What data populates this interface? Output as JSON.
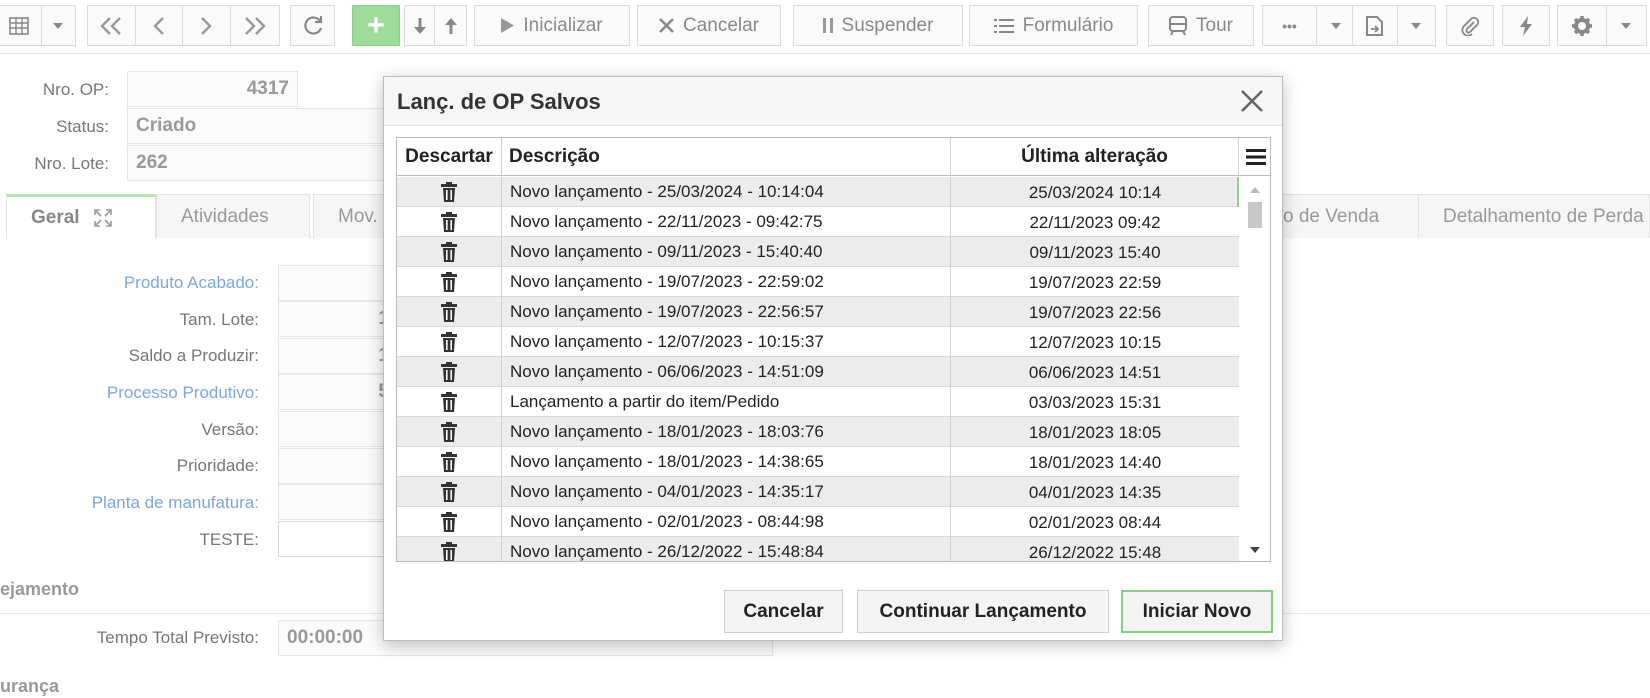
{
  "toolbar": {
    "add_label": "+",
    "start_label": "Inicializar",
    "cancel_label": "Cancelar",
    "suspend_label": "Suspender",
    "form_label": "Formulário",
    "tour_label": "Tour",
    "more_label": "•••"
  },
  "form": {
    "op_number_label": "Nro. OP:",
    "op_number_value": "4317",
    "status_label": "Status:",
    "status_value": "Criado",
    "lot_number_label": "Nro. Lote:",
    "lot_number_value": "262",
    "tabs": [
      {
        "label": "Geral"
      },
      {
        "label": "Atividades"
      },
      {
        "label": "Mov."
      },
      {
        "label": "o de Venda"
      },
      {
        "label": "Detalhamento de Perda"
      }
    ],
    "fields": [
      {
        "label": "Produto Acabado:",
        "value": ""
      },
      {
        "label": "Tam. Lote:",
        "value": "1"
      },
      {
        "label": "Saldo a Produzir:",
        "value": "1"
      },
      {
        "label": "Processo Produtivo:",
        "value": "5"
      },
      {
        "label": "Versão:",
        "value": ""
      },
      {
        "label": "Prioridade:",
        "value": ""
      },
      {
        "label": "Planta de manufatura:",
        "value": ""
      },
      {
        "label": "TESTE:",
        "value": ""
      }
    ],
    "planning_section": "ejamento",
    "total_time_label": "Tempo Total Previsto:",
    "total_time_value": "00:00:00",
    "security_section": "urança"
  },
  "dialog": {
    "title": "Lanç. de OP Salvos",
    "columns": {
      "discard": "Descartar",
      "description": "Descrição",
      "last_change": "Última alteração"
    },
    "rows": [
      {
        "description": "Novo lançamento - 25/03/2024 - 10:14:04",
        "last_change": "25/03/2024 10:14"
      },
      {
        "description": "Novo lançamento - 22/11/2023 - 09:42:75",
        "last_change": "22/11/2023 09:42"
      },
      {
        "description": "Novo lançamento - 09/11/2023 - 15:40:40",
        "last_change": "09/11/2023 15:40"
      },
      {
        "description": "Novo lançamento - 19/07/2023 - 22:59:02",
        "last_change": "19/07/2023 22:59"
      },
      {
        "description": "Novo lançamento - 19/07/2023 - 22:56:57",
        "last_change": "19/07/2023 22:56"
      },
      {
        "description": "Novo lançamento - 12/07/2023 - 10:15:37",
        "last_change": "12/07/2023 10:15"
      },
      {
        "description": "Novo lançamento - 06/06/2023 - 14:51:09",
        "last_change": "06/06/2023 14:51"
      },
      {
        "description": "Lançamento a partir do item/Pedido",
        "last_change": "03/03/2023 15:31"
      },
      {
        "description": "Novo lançamento - 18/01/2023 - 18:03:76",
        "last_change": "18/01/2023 18:05"
      },
      {
        "description": "Novo lançamento - 18/01/2023 - 14:38:65",
        "last_change": "18/01/2023 14:40"
      },
      {
        "description": "Novo lançamento - 04/01/2023 - 14:35:17",
        "last_change": "04/01/2023 14:35"
      },
      {
        "description": "Novo lançamento - 02/01/2023 - 08:44:98",
        "last_change": "02/01/2023 08:44"
      },
      {
        "description": "Novo lançamento - 26/12/2022 - 15:48:84",
        "last_change": "26/12/2022 15:48"
      }
    ],
    "buttons": {
      "cancel": "Cancelar",
      "continue": "Continuar Lançamento",
      "start_new": "Iniciar Novo"
    }
  }
}
